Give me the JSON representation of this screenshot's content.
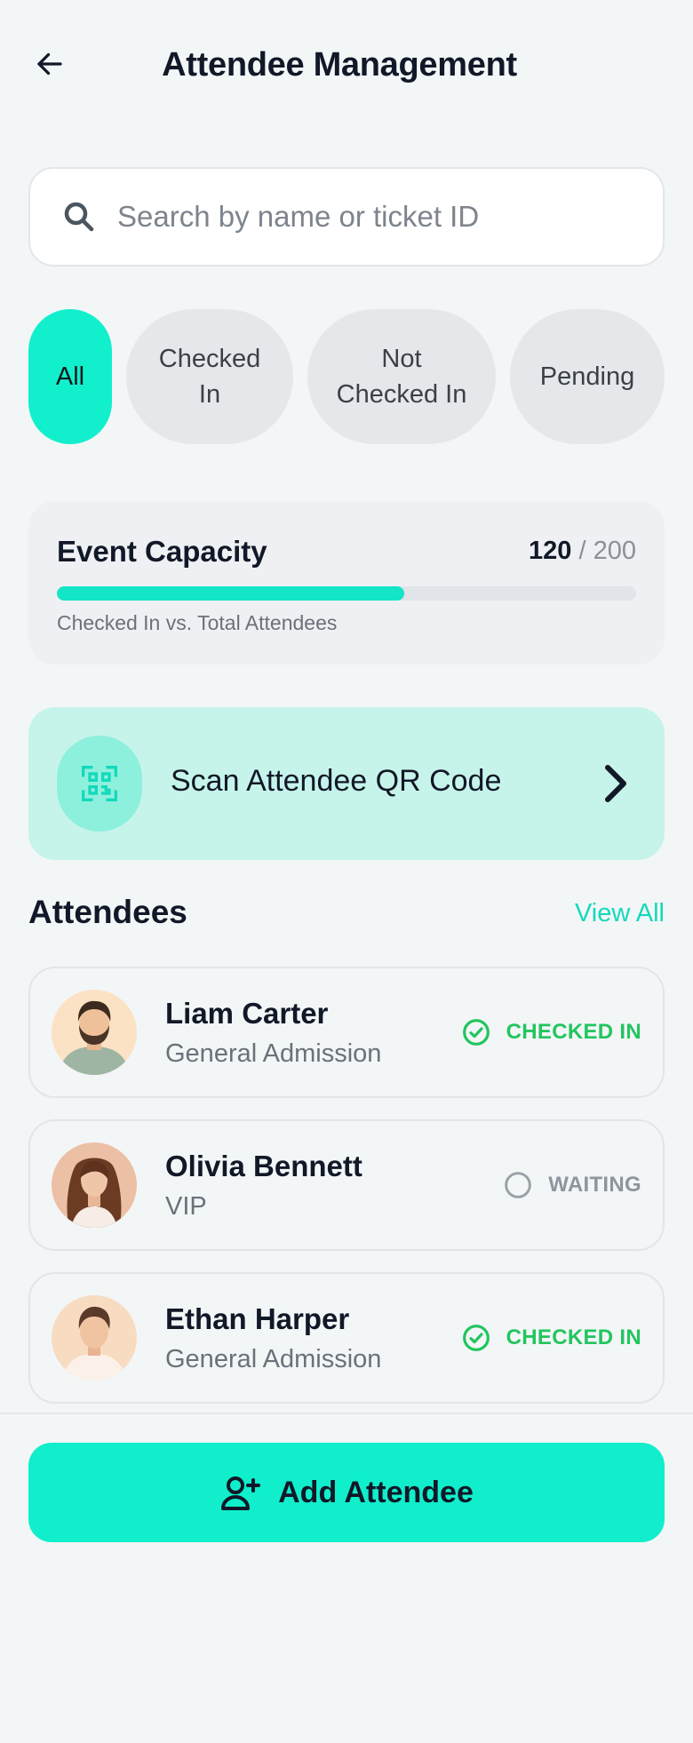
{
  "header": {
    "title": "Attendee Management",
    "back_icon": "arrow-left-icon"
  },
  "search": {
    "placeholder": "Search by name or ticket ID",
    "value": ""
  },
  "filters": [
    {
      "label": "All",
      "active": true
    },
    {
      "label": "Checked In",
      "active": false
    },
    {
      "label": "Not Checked In",
      "active": false
    },
    {
      "label": "Pending",
      "active": false
    }
  ],
  "capacity": {
    "title": "Event Capacity",
    "checked_in": "120",
    "separator": "/",
    "total": "200",
    "subtitle": "Checked In vs. Total Attendees",
    "progress_fraction": 0.6
  },
  "scan": {
    "label": "Scan Attendee QR Code",
    "icon": "qr-code-icon"
  },
  "attendees_section": {
    "title": "Attendees",
    "view_all": "View All"
  },
  "attendees": [
    {
      "name": "Liam Carter",
      "ticket": "General Admission",
      "status": "CHECKED IN",
      "status_type": "checked"
    },
    {
      "name": "Olivia Bennett",
      "ticket": "VIP",
      "status": "WAITING",
      "status_type": "waiting"
    },
    {
      "name": "Ethan Harper",
      "ticket": "General Admission",
      "status": "CHECKED IN",
      "status_type": "checked"
    }
  ],
  "add_button": {
    "label": "Add Attendee",
    "icon": "user-plus-icon"
  },
  "colors": {
    "accent": "#12efcc",
    "success": "#22c55e",
    "muted": "#8f959c",
    "background": "#f3f6f7"
  }
}
